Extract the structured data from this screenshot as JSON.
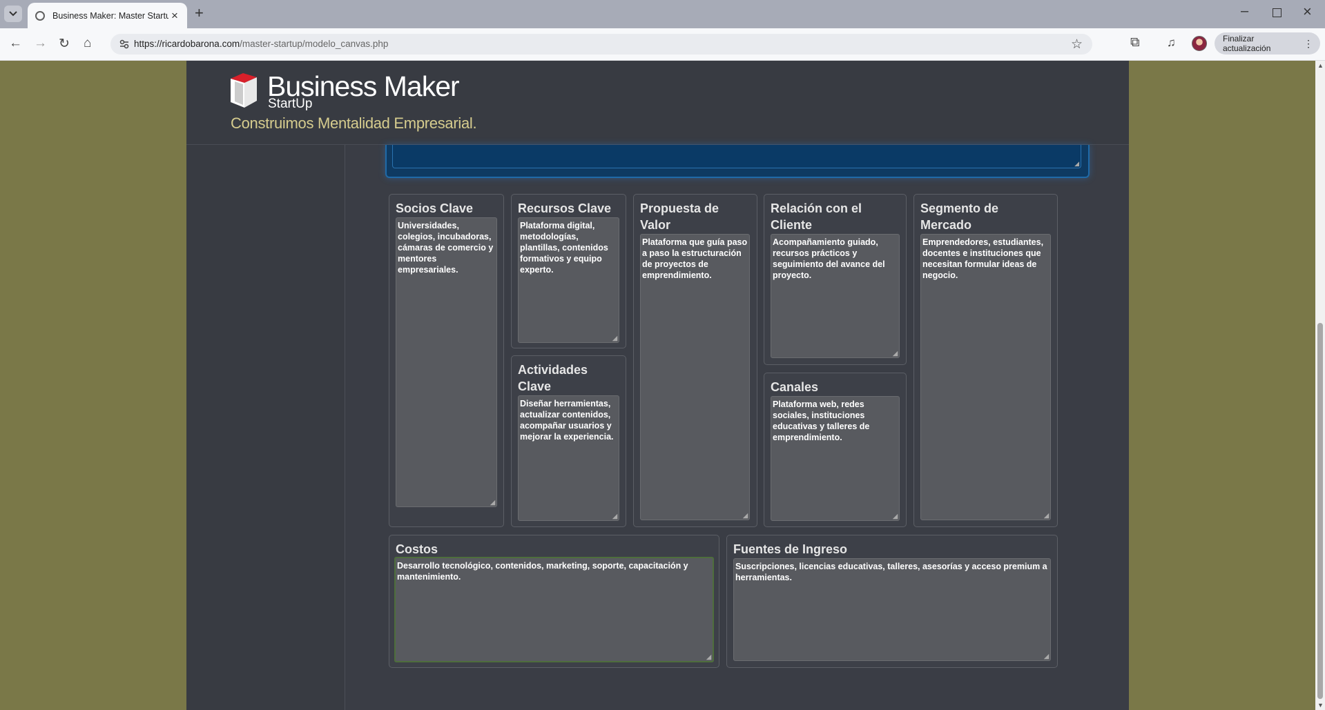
{
  "browser": {
    "tab_title": "Business Maker: Master Startup",
    "url_domain": "https://ricardobarona.com",
    "url_path": "/master-startup/modelo_canvas.php",
    "update_button": "Finalizar actualización",
    "icons": {
      "tab_list": "chevron-down-icon",
      "close": "close-icon",
      "new_tab": "plus-icon",
      "back": "arrow-left-icon",
      "forward": "arrow-right-icon",
      "reload": "reload-icon",
      "home": "home-icon",
      "star": "star-icon",
      "extensions": "puzzle-icon",
      "media": "media-control-icon",
      "menu": "kebab-menu-icon"
    }
  },
  "brand": {
    "name": "Business Maker",
    "sub": "StartUp",
    "tagline": "Construimos Mentalidad Empresarial.",
    "colors": {
      "tagline": "#d6cc8e",
      "background": "#3a3d45",
      "outer": "#7a7848"
    }
  },
  "canvas": {
    "socios": {
      "title": "Socios Clave",
      "text": "Universidades, colegios, incubadoras, cámaras de comercio y mentores empresariales."
    },
    "recursos": {
      "title": "Recursos Clave",
      "text": "Plataforma digital, metodologías, plantillas, contenidos formativos y equipo experto."
    },
    "actividades": {
      "title": "Actividades Clave",
      "text": "Diseñar herramientas, actualizar contenidos, acompañar usuarios y mejorar la experiencia."
    },
    "propuesta": {
      "title": "Propuesta de Valor",
      "text": "Plataforma que guía paso a paso la estructuración de proyectos de emprendimiento."
    },
    "relacion": {
      "title": "Relación con el Cliente",
      "text": "Acompañamiento guiado, recursos prácticos y seguimiento del avance del proyecto."
    },
    "canales": {
      "title": "Canales",
      "text": "Plataforma web, redes sociales, instituciones educativas y talleres de emprendimiento."
    },
    "segmento": {
      "title": "Segmento de Mercado",
      "text": "Emprendedores, estudiantes, docentes e instituciones que necesitan formular ideas de negocio."
    },
    "costos": {
      "title": "Costos",
      "text": "Desarrollo tecnológico, contenidos, marketing, soporte, capacitación y mantenimiento."
    },
    "ingresos": {
      "title": "Fuentes de Ingreso",
      "text": "Suscripciones, licencias educativas, talleres, asesorías y acceso premium a herramientas."
    }
  }
}
